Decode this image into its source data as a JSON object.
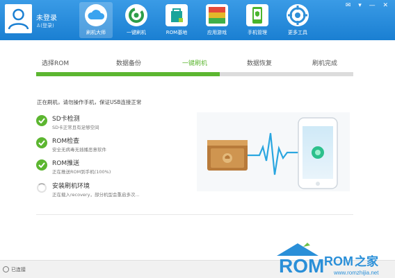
{
  "header": {
    "user": {
      "name": "未登录",
      "login_link": "(登录)"
    },
    "nav": [
      {
        "label": "刷机大师",
        "icon": "cloud-icon",
        "color": "#3aa3ef",
        "active": true
      },
      {
        "label": "一键刷机",
        "icon": "refresh-icon",
        "color": "#2e9e4a"
      },
      {
        "label": "ROM基地",
        "icon": "rom-bag-icon",
        "color": "#1aa49a"
      },
      {
        "label": "应用游戏",
        "icon": "apps-icon",
        "color": "#e4b72a"
      },
      {
        "label": "手机管理",
        "icon": "phone-shield-icon",
        "color": "#4ab52d"
      },
      {
        "label": "更多工具",
        "icon": "tools-icon",
        "color": "#2e8fd8"
      }
    ],
    "window_controls": "✉ ▾ — ✕"
  },
  "steps": [
    {
      "label": "选择ROM"
    },
    {
      "label": "数据备份"
    },
    {
      "label": "一键刷机",
      "active": true
    },
    {
      "label": "数据恢复"
    },
    {
      "label": "刷机完成"
    }
  ],
  "progress": {
    "fraction": 0.58,
    "color": "#5cb630"
  },
  "status_text": "正在刷机，请勿操作手机，保证USB连接正常",
  "tasks": [
    {
      "title": "SD卡检测",
      "desc": "SD卡正常且有足够空间",
      "state": "done"
    },
    {
      "title": "ROM检查",
      "desc": "安全无病毒无插播恶意软件",
      "state": "done"
    },
    {
      "title": "ROM推送",
      "desc": "正在推送ROM到手机(100%)",
      "state": "done"
    },
    {
      "title": "安装刷机环境",
      "desc": "正在载入recovery，部分机型会重启多次...",
      "state": "loading"
    }
  ],
  "footer": {
    "connection": "已连接"
  },
  "watermark": {
    "text": "ROM之家",
    "url": "www.romzhijia.net"
  }
}
